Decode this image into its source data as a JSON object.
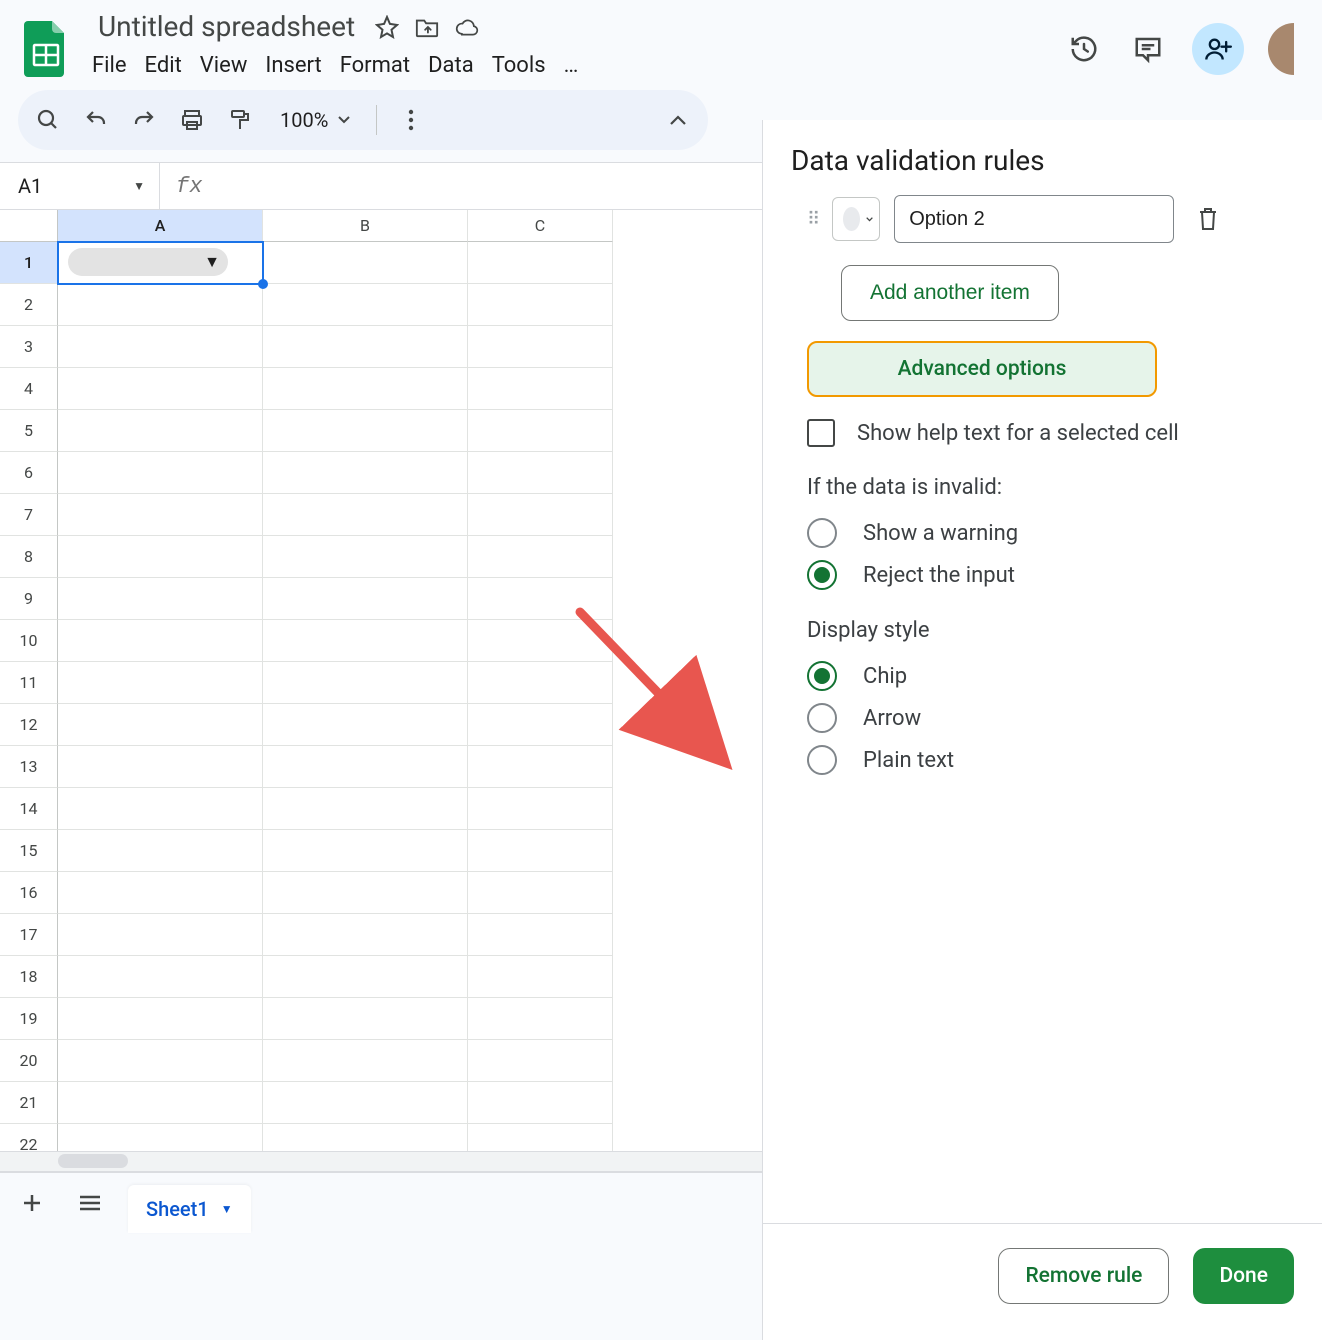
{
  "title": "Untitled spreadsheet",
  "menubar": [
    "File",
    "Edit",
    "View",
    "Insert",
    "Format",
    "Data",
    "Tools",
    "…"
  ],
  "toolbar": {
    "zoom": "100%"
  },
  "name_box": "A1",
  "columns": [
    "A",
    "B",
    "C"
  ],
  "rows": [
    1,
    2,
    3,
    4,
    5,
    6,
    7,
    8,
    9,
    10,
    11,
    12,
    13,
    14,
    15,
    16,
    17,
    18,
    19,
    20,
    21,
    22
  ],
  "tabbar": {
    "sheet": "Sheet1"
  },
  "panel": {
    "title": "Data validation rules",
    "option_value": "Option 2",
    "add_item": "Add another item",
    "advanced": "Advanced options",
    "help_text_label": "Show help text for a selected cell",
    "invalid_section": "If the data is invalid:",
    "invalid_opts": [
      "Show a warning",
      "Reject the input"
    ],
    "invalid_selected": 1,
    "display_section": "Display style",
    "display_opts": [
      "Chip",
      "Arrow",
      "Plain text"
    ],
    "display_selected": 0,
    "remove": "Remove rule",
    "done": "Done"
  }
}
